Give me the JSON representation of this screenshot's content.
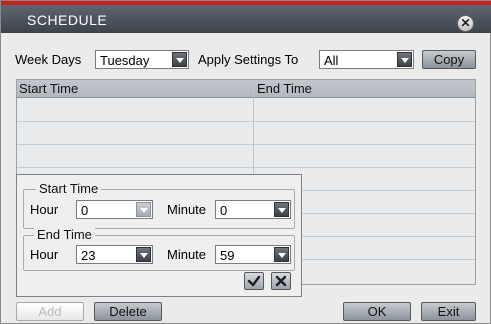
{
  "window": {
    "title": "SCHEDULE",
    "close_glyph": "✕"
  },
  "filters": {
    "week_days_label": "Week Days",
    "week_days_value": "Tuesday",
    "apply_label": "Apply Settings To",
    "apply_value": "All",
    "copy_label": "Copy"
  },
  "table": {
    "columns": [
      "Start Time",
      "End Time"
    ],
    "row_count": 8
  },
  "editor": {
    "start_group": "Start Time",
    "end_group": "End Time",
    "hour_label": "Hour",
    "minute_label": "Minute",
    "start_hour": "0",
    "start_minute": "0",
    "end_hour": "23",
    "end_minute": "59",
    "confirm_icon": "check-icon",
    "cancel_icon": "close-icon"
  },
  "footer": {
    "add_label": "Add",
    "delete_label": "Delete",
    "ok_label": "OK",
    "exit_label": "Exit"
  }
}
